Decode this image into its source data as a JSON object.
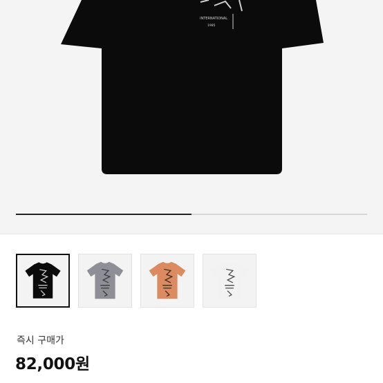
{
  "hero": {
    "shirt_color": "#0b0b0b",
    "print_text": "INTERNATIONAL",
    "print_subtext": "1985",
    "carousel_progress": 0.5
  },
  "thumbnails": [
    {
      "name": "black",
      "color": "#0b0b0b",
      "print": "#cfcfcf",
      "selected": true
    },
    {
      "name": "gray",
      "color": "#8e8e96",
      "print": "#3a3a3a",
      "selected": false
    },
    {
      "name": "orange",
      "color": "#dc8a5f",
      "print": "#3a2a22",
      "selected": false
    },
    {
      "name": "white",
      "color": "#f2f2f2",
      "print": "#4a4a4a",
      "selected": false
    }
  ],
  "purchase": {
    "label": "즉시 구매가",
    "price": "82,000원"
  }
}
